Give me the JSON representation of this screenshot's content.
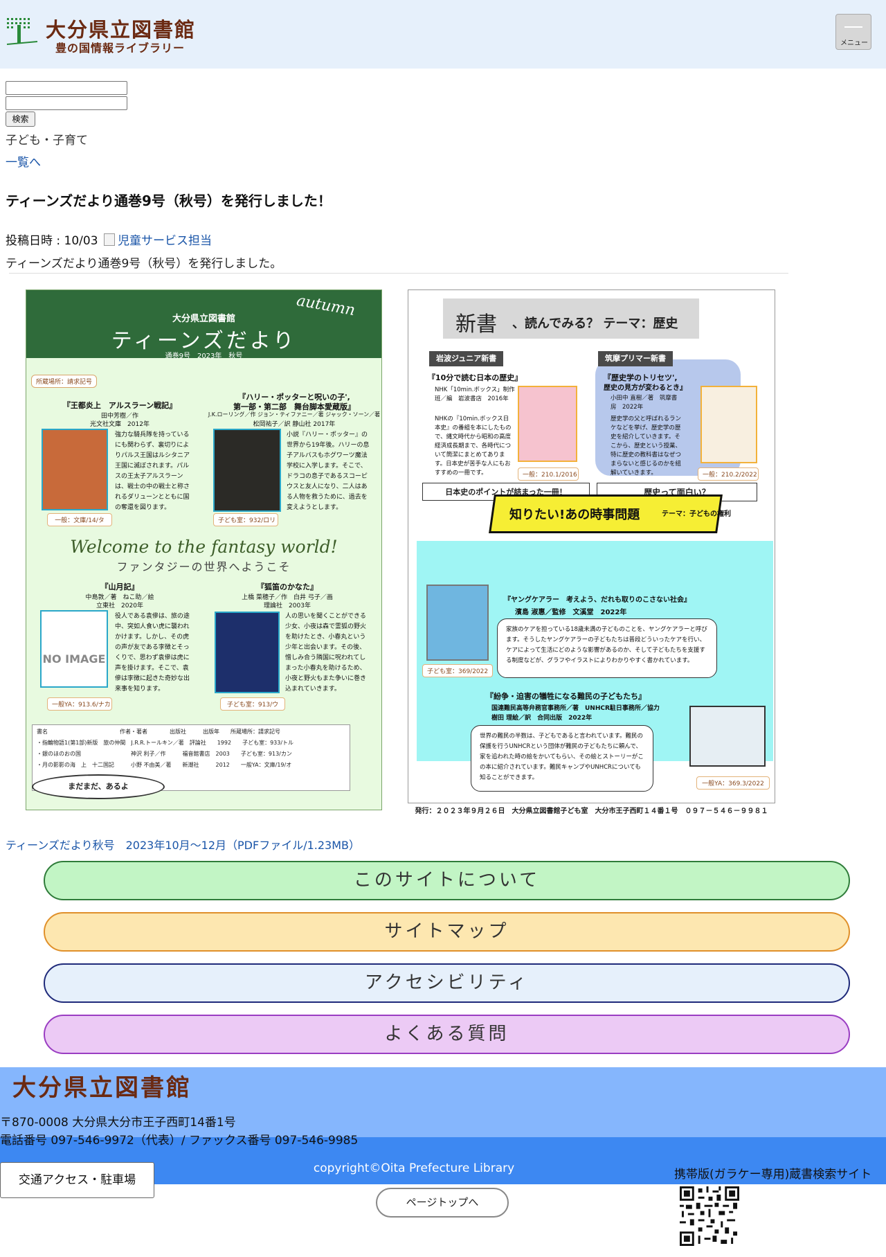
{
  "header": {
    "logo_title": "大分県立図書館",
    "logo_subtitle": "豊の国情報ライブラリー",
    "menu_label": "メニュー"
  },
  "search": {
    "button_label": "検索",
    "input1_value": "",
    "input2_value": ""
  },
  "breadcrumb": {
    "category": "子ども・子育て",
    "list_link": "一覧へ"
  },
  "article": {
    "title": "ティーンズだより通巻9号（秋号）を発行しました！",
    "posted_label": "投稿日時 : 10/03",
    "author": "児童サービス担当",
    "lead": "ティーンズだより通巻9号（秋号）を発行しました。"
  },
  "newsletter_left": {
    "org": "大分県立図書館",
    "title": "ティーンズだより",
    "issue": "通巻9号　2023年　秋号",
    "autumn": "autumn",
    "location_label": "所蔵場所：請求記号",
    "books": [
      {
        "title": "『王都炎上　アルスラーン戦記』",
        "meta1": "田中芳樹／作",
        "meta2": "光文社文庫　2012年",
        "desc": "強力な騎兵隊を持っているにも関わらず、裏切りによりパルス王国はルシタニア王国に滅ぼされます。パルスの王太子アルスラーンは、戦士の中の戦士と称されるダリューンとともに国の奪還を図ります。",
        "call": "一般：文庫/14/タ",
        "cover_text": "王都炎上"
      },
      {
        "title": "『ハリー・ポッターと呪いの子',",
        "title_line2": "第一部・第二部　舞台脚本愛蔵版』",
        "meta1": "J.K.ローリング／作  ジョン・ティファニー／著  ジャック・ソーン／著",
        "meta2": "松岡祐子／訳  静山社  2017年",
        "desc": "小説『ハリー・ポッター』の世界から19年後。ハリーの息子アルバスもホグワーツ魔法学校に入学します。そこで、ドラコの息子であるスコーピウスと友人になり、二人はある人物を救うために、過去を変えようとします。",
        "call": "子ども室：932/ロリ",
        "cover_text": "ハリー・ポッターと呪いの子"
      },
      {
        "title": "『山月記』",
        "meta1": "中島敦／著　ねこ助／絵",
        "meta2": "立東社　2020年",
        "desc": "役人である袁傪は、旅の途中、突如人食い虎に襲われかけます。しかし、その虎の声が友である李徴とそっくりで、思わず袁傪は虎に声を掛けます。そこで、袁傪は李徴に起きた奇妙な出来事を知ります。",
        "call": "一般YA：913.6/ナカ",
        "no_image": "NO IMAGE"
      },
      {
        "title": "『狐笛のかなた』",
        "meta1": "上橋 菜穂子／作　白井 弓子／画",
        "meta2": "理論社　2003年",
        "desc": "人の思いを聞くことができる少女、小夜は森で霊狐の野火を助けたとき、小春丸という少年と出会います。その後、憎しみ合う隣国に呪われてしまった小春丸を助けるため、小夜と野火もまた争いに巻き込まれていきます。",
        "call": "子ども室：913/ウ",
        "cover_text": "孤笛のかなた"
      }
    ],
    "welcome": "Welcome to the fantasy world!",
    "welcome_sub": "ファンタジーの世界へようこそ",
    "table_header": "書名　　　　　　　　　　　　　作者・著者　　　　出版社　　　出版年　　所蔵場所：請求記号",
    "table_rows": [
      "・指輪物語1(第1部)新版　旅の仲間　J.R.R.トールキン／著　評論社　　1992　　子ども室：933/トル",
      "・銀のほのおの国　　　　　　　　　神沢 利子／作　　　福音館書店　2003　　子ども室：913/カン",
      "・月の影影の海　上　十二国記　　　小野 不由美／著　　新潮社　　　2012　　一般YA：文庫/19/オ"
    ],
    "more_label": "まだまだ、あるよ"
  },
  "newsletter_right": {
    "header_main": "新書",
    "header_sub": "、読んでみる？ テーマ：歴史",
    "books": [
      {
        "series": "岩波ジュニア新書",
        "title": "『10分で読む日本の歴史』",
        "meta": "NHK「10min.ボックス」制作班／編　岩波書店　2016年",
        "desc": "NHKの『10min.ボックス日本史』の番組を本にしたもので、縄文時代から昭和の高度経済成長期まで、各時代について簡潔にまとめてあります。日本史が苦手な人にもおすすめの一冊です。",
        "call": "一般：210.1/2016",
        "comment": "日本史のポイントが詰まった一冊！"
      },
      {
        "series": "筑摩プリマー新書",
        "title": "『歴史学のトリセツ',",
        "title_line2": "歴史の見方が変わるとき』",
        "meta": "小田中 直樹／著　筑摩書房　2022年",
        "desc": "歴史学の父と呼ばれるランケなどを挙げ、歴史学の歴史を紹介していきます。そこから、歴史という授業、特に歴史の教科書はなぜつまらないと感じるのかを紐解いていきます。",
        "call": "一般：210.2/2022",
        "comment": "歴史って面白い？"
      }
    ],
    "banner": "知りたい!あの時事問題",
    "banner_theme": "テーマ：子どもの権利",
    "topic_books": [
      {
        "title": "『ヤングケアラー　考えよう、だれも取りのこさない社会』",
        "meta": "濱島 淑惠／監修　文溪堂　2022年",
        "desc": "家族のケアを担っている18歳未満の子どものことを、ヤングケアラーと呼びます。そうしたヤングケアラーの子どもたちは普段どういったケアを行い、ケアによって生活にどのような影響があるのか、そして子どもたちを支援する制度などが、グラフやイラストによりわかりやすく書かれています。",
        "call": "子ども室：369/2022",
        "cover_text": "ヤングケアラー"
      },
      {
        "title": "『紛争・迫害の犠牲になる難民の子どもたち』",
        "meta1": "国連難民高等弁務官事務所／著　UNHCR駐日事務所／協力",
        "meta2": "樹田 理絵／訳　合同出版　2022年",
        "desc": "世界の難民の半数は、子どもであると言われています。難民の保護を行うUNHCRという団体が難民の子どもたちに頼んで、家を追われた時の絵をかいてもらい、その絵とストーリーがこの本に紹介されています。難民キャンプやUNHCRについても知ることができます。",
        "call": "一般YA：369.3/2022",
        "cover_text": "難民の子どもたち"
      }
    ],
    "footer": "発行：２０２３年９月２６日　大分県立図書館子ども室　大分市王子西町１４番１号　０９７－５４６－９９８１"
  },
  "pdf_link": "ティーンズだより秋号　2023年10月〜12月（PDFファイル/1.23MB）",
  "footer_buttons": {
    "about": "このサイトについて",
    "sitemap": "サイトマップ",
    "accessibility": "アクセシビリティ",
    "faq": "よくある質問"
  },
  "footer": {
    "logo": "大分県立図書館",
    "address": "〒870-0008 大分県大分市王子西町14番1号",
    "tel": "電話番号 097-546-9972（代表）/ ファックス番号 097-546-9985",
    "copyright": "copyright©Oita Prefecture Library",
    "access_button": "交通アクセス・駐車場",
    "mobile_label": "携帯版(ガラケー専用)蔵書検索サイト",
    "page_top": "ページトップへ"
  },
  "colors": {
    "header_bg": "#e6f0fb",
    "brand_brown": "#6b2a12",
    "link": "#1a55a8",
    "footer_light": "#85b6fd",
    "footer_dark": "#3d88f2"
  }
}
